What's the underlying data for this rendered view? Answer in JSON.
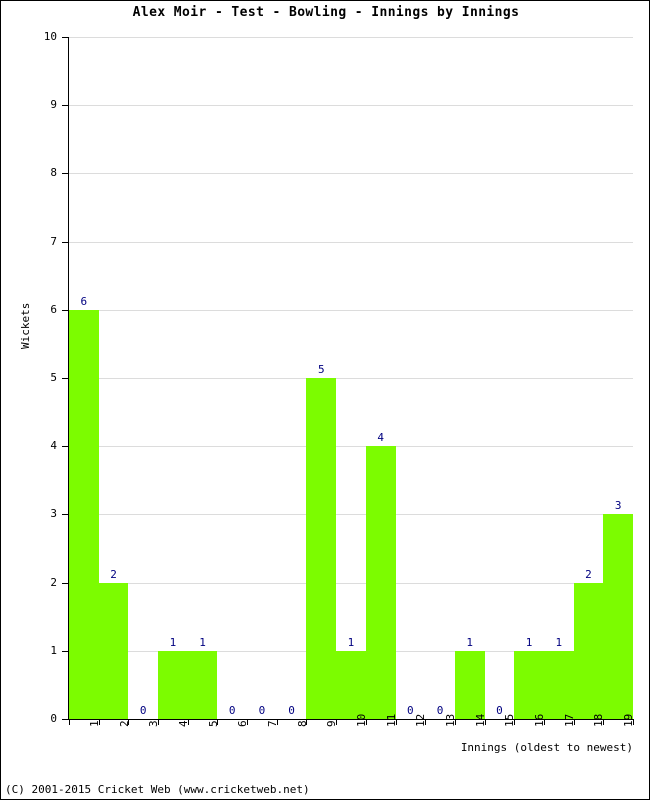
{
  "chart_data": {
    "type": "bar",
    "title": "Alex Moir - Test - Bowling - Innings by Innings",
    "xlabel": "Innings (oldest to newest)",
    "ylabel": "Wickets",
    "categories": [
      "1",
      "2",
      "3",
      "4",
      "5",
      "6",
      "7",
      "8",
      "9",
      "10",
      "11",
      "12",
      "13",
      "14",
      "15",
      "16",
      "17",
      "18",
      "19"
    ],
    "values": [
      6,
      2,
      0,
      1,
      1,
      0,
      0,
      0,
      5,
      1,
      4,
      0,
      0,
      1,
      0,
      1,
      1,
      2,
      3
    ],
    "ylim": [
      0,
      10
    ],
    "ytick_labels": [
      "0",
      "1",
      "2",
      "3",
      "4",
      "5",
      "6",
      "7",
      "8",
      "9",
      "10"
    ],
    "grid": true,
    "legend": false,
    "bar_color": "#7CFC00",
    "bar_label_color": "#000080",
    "gridline_color": "#DCDCDC",
    "axis_color": "#000000",
    "background": "#FFFFFF"
  },
  "footer": {
    "copyright": "(C) 2001-2015 Cricket Web (www.cricketweb.net)"
  }
}
